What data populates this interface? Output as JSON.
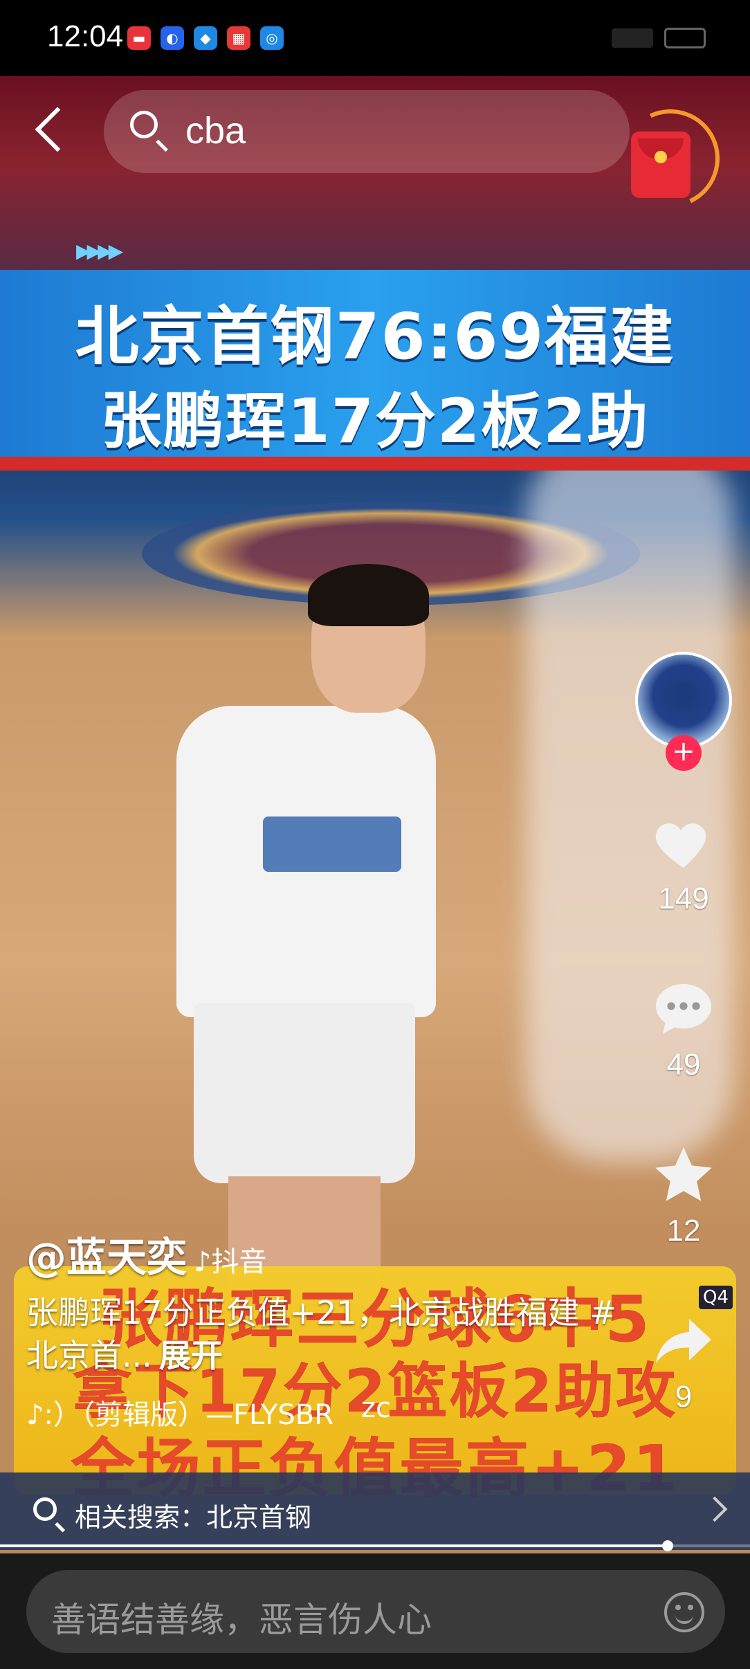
{
  "status_bar": {
    "time": "12:04",
    "app_icons": [
      {
        "name": "huawei-app-icon",
        "color": "#e8333a"
      },
      {
        "name": "bulb-app-icon",
        "color": "#2563eb"
      },
      {
        "name": "browser-app-icon",
        "color": "#1e88e5"
      },
      {
        "name": "calendar-app-icon",
        "color": "#e53935"
      },
      {
        "name": "search-app-icon",
        "color": "#1e88e5"
      }
    ]
  },
  "search": {
    "query": "cba"
  },
  "video": {
    "banner_line1": "北京首钢76:69福建",
    "banner_line2": "张鹏珲17分2板2助",
    "bottom_line1": "张鹏珲三分球6中5",
    "bottom_line2": "拿下17分2篮板2助攻",
    "bottom_line3": "全场正负值最高+21",
    "quarter_badge": "Q4"
  },
  "actions": {
    "likes": "149",
    "comments": "49",
    "favorites": "12",
    "shares": "9"
  },
  "caption": {
    "author": "@蓝天奕",
    "platform": "♪抖音",
    "description": "张鹏珲17分正负值+21，北京战胜福建 #北京首...",
    "expand_label": "展开",
    "music": "♪:）（剪辑版）—FLYSBR",
    "music_trailing": "zc"
  },
  "related_search": {
    "label": "相关搜索：北京首钢"
  },
  "progress": {
    "fraction": 0.89
  },
  "comment_input": {
    "placeholder": "善语结善缘，恶言伤人心"
  },
  "colors": {
    "follow_accent": "#fe2c55",
    "banner_blue": "#2aa0ee",
    "bottom_banner_yellow": "#f5cd2a"
  }
}
